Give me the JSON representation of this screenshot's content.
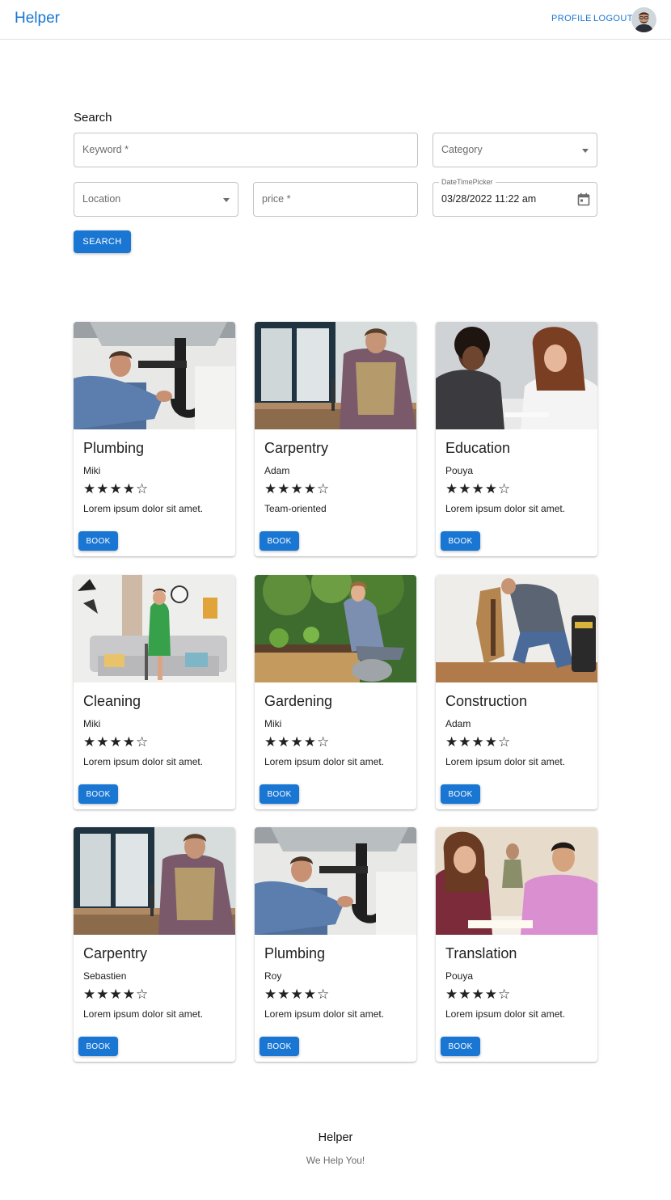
{
  "app": {
    "title": "Helper"
  },
  "nav": {
    "profile_label": "PROFILE",
    "logout_label": "LOGOUT"
  },
  "search": {
    "heading": "Search",
    "keyword_placeholder": "Keyword *",
    "category_placeholder": "Category",
    "location_placeholder": "Location",
    "price_placeholder": "price *",
    "date_label": "DateTimePicker",
    "date_value": "03/28/2022 11:22 am",
    "button_label": "SEARCH"
  },
  "cards": [
    {
      "title": "Plumbing",
      "author": "Miki",
      "rating": 4,
      "stars": "★★★★☆",
      "description": "Lorem ipsum dolor sit amet.",
      "button": "BOOK",
      "image": "plumber-photo"
    },
    {
      "title": "Carpentry",
      "author": "Adam",
      "rating": 4,
      "stars": "★★★★☆",
      "description": "Team-oriented",
      "button": "BOOK",
      "image": "carpenter-photo"
    },
    {
      "title": "Education",
      "author": "Pouya",
      "rating": 4,
      "stars": "★★★★☆",
      "description": "Lorem ipsum dolor sit amet.",
      "button": "BOOK",
      "image": "students-photo"
    },
    {
      "title": "Cleaning",
      "author": "Miki",
      "rating": 4,
      "stars": "★★★★☆",
      "description": "Lorem ipsum dolor sit amet.",
      "button": "BOOK",
      "image": "cleaner-photo"
    },
    {
      "title": "Gardening",
      "author": "Miki",
      "rating": 4,
      "stars": "★★★★☆",
      "description": "Lorem ipsum dolor sit amet.",
      "button": "BOOK",
      "image": "gardener-photo"
    },
    {
      "title": "Construction",
      "author": "Adam",
      "rating": 4,
      "stars": "★★★★☆",
      "description": "Lorem ipsum dolor sit amet.",
      "button": "BOOK",
      "image": "construction-photo"
    },
    {
      "title": "Carpentry",
      "author": "Sebastien",
      "rating": 4,
      "stars": "★★★★☆",
      "description": "Lorem ipsum dolor sit amet.",
      "button": "BOOK",
      "image": "carpenter-photo"
    },
    {
      "title": "Plumbing",
      "author": "Roy",
      "rating": 4,
      "stars": "★★★★☆",
      "description": "Lorem ipsum dolor sit amet.",
      "button": "BOOK",
      "image": "plumber-photo"
    },
    {
      "title": "Translation",
      "author": "Pouya",
      "rating": 4,
      "stars": "★★★★☆",
      "description": "Lorem ipsum dolor sit amet.",
      "button": "BOOK",
      "image": "translation-photo"
    }
  ],
  "footer": {
    "title": "Helper",
    "subtitle": "We Help You!"
  },
  "colors": {
    "primary": "#1976d2",
    "border": "#c4c4c4",
    "text": "#212121",
    "muted": "#6b6b6b"
  }
}
